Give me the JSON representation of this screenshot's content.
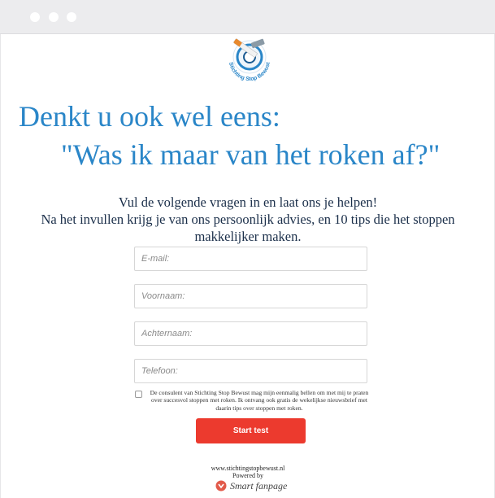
{
  "logo": {
    "text": "Stichting Stop Bewust"
  },
  "headline": {
    "line1": "Denkt u ook wel eens:",
    "line2": "\"Was ik maar van het roken af?\""
  },
  "intro": {
    "line1": "Vul de volgende vragen in en laat ons je helpen!",
    "line2": "Na het invullen krijg je van ons persoonlijk advies, en 10 tips die het stoppen makkelijker maken."
  },
  "form": {
    "email_placeholder": "E-mail:",
    "firstname_placeholder": "Voornaam:",
    "lastname_placeholder": "Achternaam:",
    "phone_placeholder": "Telefoon:",
    "consent_text": "De consulent van Stichting Stop Bewust mag mijn eenmalig bellen om met mij te praten over succesvol stoppen met roken. Ik ontvang ook gratis de wekelijkse nieuwsbrief met daarin tips over stoppen met roken.",
    "consent_checked": false,
    "submit_label": "Start test"
  },
  "footer": {
    "url": "www.stichtingstopbewust.nl",
    "powered": "Powered by",
    "brand": "Smart fanpage"
  },
  "colors": {
    "headline": "#2a86c8",
    "button": "#ec3a2e",
    "logo_blue": "#2a86c8"
  }
}
